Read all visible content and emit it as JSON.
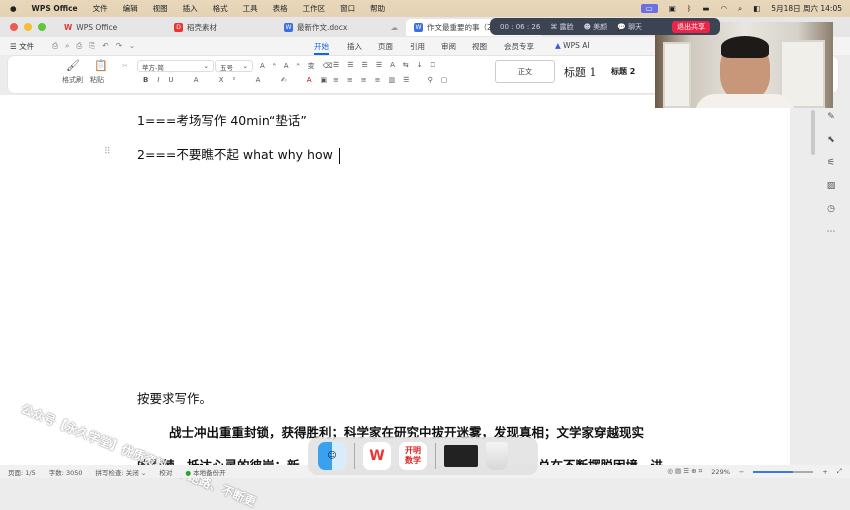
{
  "menubar": {
    "app": "WPS Office",
    "items": [
      "文件",
      "编辑",
      "视图",
      "插入",
      "格式",
      "工具",
      "表格",
      "工作区",
      "窗口",
      "帮助"
    ],
    "datetime": "5月18日 周六 14:05"
  },
  "tabs": [
    {
      "label": "WPS Office",
      "icon": "wps-logo-icon"
    },
    {
      "label": "稻壳素材",
      "icon": "docer-icon"
    },
    {
      "label": "最新作文.docx",
      "icon": "word-doc-icon"
    },
    {
      "label": "作文最重要的事（2024。",
      "icon": "word-doc-icon",
      "active": true
    }
  ],
  "nav": {
    "file": "文件",
    "ribbon_tabs": [
      "开始",
      "插入",
      "页面",
      "引用",
      "审阅",
      "视图",
      "会员专享",
      "WPS AI"
    ],
    "active": "开始"
  },
  "ribbon": {
    "format_painter": "格式刷",
    "paste": "粘贴",
    "font": "苹方-简",
    "size": "五号",
    "styles": [
      "正文",
      "标题 1",
      "标题 2"
    ]
  },
  "meeting": {
    "timer": "00 : 06 : 26",
    "beauty_face": "露脸",
    "beauty": "美颜",
    "chat": "聊天",
    "exit": "退出共享"
  },
  "document": {
    "line1": "1===考场写作  40min“垫话”",
    "line2": "2===不要瞧不起  what why how",
    "line3": "按要求写作。",
    "line4": "战士冲出重重封锁，获得胜利；科学家在研究中拔开迷雾，发现真相；文学家穿越现实",
    "line5_left": "的荆棘，抵达心灵的彼岸；新",
    "line5_right": "总在不断摆脱困境，进"
  },
  "watermark": "公众号【永久学堂】优质资料、不跑路、不断更",
  "status": {
    "page": "页面: 1/5",
    "words": "字数: 3050",
    "spell": "拼写检查: 关闭 ⌄",
    "proof": "校对",
    "backup": "本地备份开",
    "zoom": "229%"
  },
  "dock": {
    "kaiming_line1": "开明",
    "kaiming_line2": "数学"
  },
  "colors": {
    "accent": "#1a62e8",
    "exit": "#e8264a",
    "wps_red": "#e33"
  }
}
